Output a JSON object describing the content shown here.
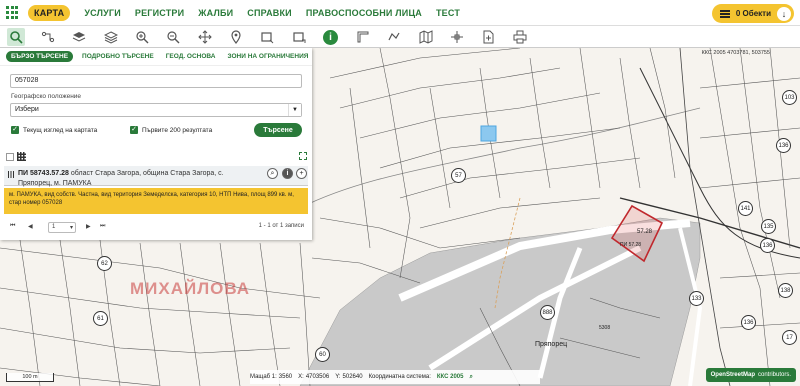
{
  "nav": {
    "active": "КАРТА",
    "items": [
      "УСЛУГИ",
      "РЕГИСТРИ",
      "ЖАЛБИ",
      "СПРАВКИ",
      "ПРАВОСПОСОБНИ ЛИЦА",
      "ТЕСТ"
    ],
    "objects_label": "0 Обекти"
  },
  "panel": {
    "tabs": [
      "БЪРЗО ТЪРСЕНЕ",
      "ПОДРОБНО ТЪРСЕНЕ",
      "ГЕОД. ОСНОВА",
      "ЗОНИ НА ОГРАНИЧЕНИЯ"
    ],
    "search_value": "057028",
    "geo_label": "Географско положение",
    "geo_value": "Избери",
    "cb_current_view": "Текущ изглед на картата",
    "cb_first_200": "Първите 200 резултата",
    "search_button": "Търсене",
    "result_id": "ПИ 58743.57.28",
    "result_location": "област Стара Загора, община Стара Загора, с. Пряпорец, м. ПАМУКА",
    "result_desc": "м. ПАМУКА, вид собств. Частна, вид територия Земеделска, категория 10, НТП Нива, площ 899 кв. м, стар номер 057028",
    "page_value": "1",
    "pager_summary": "1 - 1 от 1 записи"
  },
  "map": {
    "coord_top": "ККС 2005 4703781, 503755",
    "area_label": "МИХАЙЛОВА",
    "village_label": "Пряпорец",
    "road_label": "5308",
    "parcel_label": "57.28",
    "highlight_label": "ПИ 57.28",
    "parcel_numbers": [
      "57",
      "62",
      "61",
      "60",
      "888",
      "133",
      "135",
      "136",
      "141",
      "136",
      "136",
      "138",
      "103",
      "17"
    ]
  },
  "status": {
    "scale_label": "Мащаб 1:",
    "scale_value": "3560",
    "x_label": "X:",
    "x_value": "4703506",
    "y_label": "Y:",
    "y_value": "502640",
    "crs_label": "Координатна система:",
    "crs_value": "ККС 2005",
    "scalebar": "100 m",
    "osm": "OpenStreetMap",
    "osm_suffix": "contributors."
  },
  "colors": {
    "brand_green": "#2a7a3a",
    "accent_yellow": "#f4c430",
    "highlight_red": "#c0282d",
    "selected_blue": "#4da6e0"
  }
}
